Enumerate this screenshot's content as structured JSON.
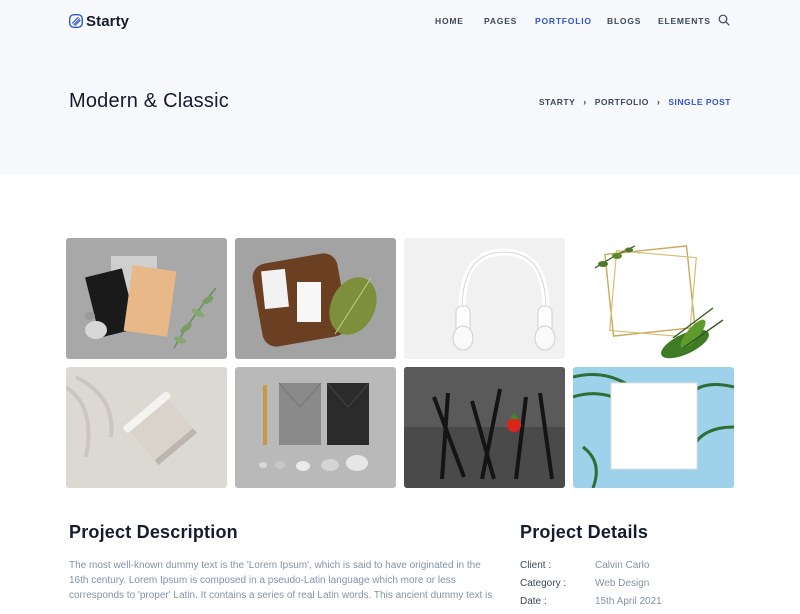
{
  "brand": {
    "name": "Starty",
    "accent": "#2f55d4"
  },
  "nav": {
    "items": [
      {
        "label": "HOME",
        "active": false
      },
      {
        "label": "PAGES",
        "active": false
      },
      {
        "label": "PORTFOLIO",
        "active": true
      },
      {
        "label": "BLOGS",
        "active": false
      },
      {
        "label": "ELEMENTS",
        "active": false
      }
    ],
    "search_icon": "search-icon"
  },
  "hero": {
    "title": "Modern & Classic",
    "breadcrumb": [
      "STARTY",
      "PORTFOLIO",
      "SINGLE POST"
    ]
  },
  "gallery": {
    "images": [
      "stationery-cards-with-plant",
      "business-cards-on-wooden-board-with-leaf",
      "white-headphones",
      "gold-frames-with-leaves",
      "paper-coffee-cup",
      "envelopes-and-pencil",
      "black-forks-with-strawberry",
      "white-card-with-palm-leaves"
    ]
  },
  "project_description": {
    "title": "Project Description",
    "text": "The most well-known dummy text is the 'Lorem Ipsum', which is said to have originated in the 16th century. Lorem Ipsum is composed in a pseudo-Latin language which more or less corresponds to 'proper' Latin. It contains a series of real Latin words. This ancient dummy text is"
  },
  "project_details": {
    "title": "Project Details",
    "rows": [
      {
        "key": "Client :",
        "value": "Calvin Carlo"
      },
      {
        "key": "Category :",
        "value": "Web Design"
      },
      {
        "key": "Date :",
        "value": "15th April 2021"
      }
    ]
  }
}
